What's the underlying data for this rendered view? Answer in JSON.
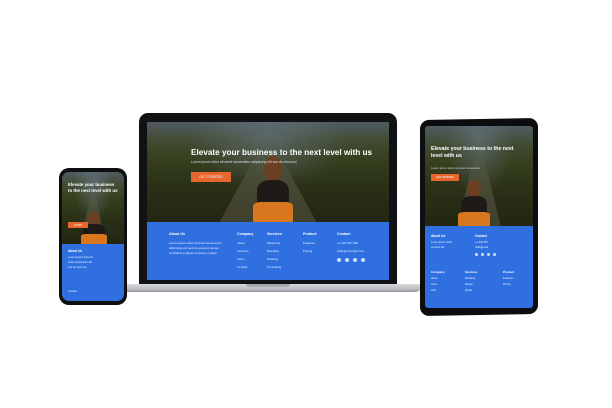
{
  "laptop": {
    "hero_title": "Elevate your business to the next level with us",
    "hero_subtitle": "Lorem ipsum dolor sit amet consectetur adipiscing elit sed do eiusmod",
    "cta_label": "GET STARTED",
    "footer": {
      "about_heading": "About Us",
      "about_lines": [
        "Lorem ipsum dolor sit amet consectetur",
        "adipiscing elit sed do eiusmod tempor",
        "incididunt ut labore et dolore magna"
      ],
      "col1_heading": "Company",
      "col1_items": [
        "About",
        "Services",
        "Team",
        "Contact"
      ],
      "col2_heading": "Services",
      "col2_items": [
        "Marketing",
        "Branding",
        "Strategy",
        "Consulting"
      ],
      "col3_heading": "Product",
      "col3_items": [
        "Features",
        "Pricing"
      ],
      "contact_heading": "Contact",
      "contact_lines": [
        "+1 234 567 890",
        "hello@example.com"
      ]
    }
  },
  "phone": {
    "hero_title": "Elevate your business to the next level with us",
    "cta_label": "START",
    "footer_heading": "About Us",
    "footer_lines": [
      "Lorem ipsum dolor sit",
      "amet consectetur elit",
      "sed do eiusmod"
    ],
    "footer_link": "Contact"
  },
  "tablet": {
    "hero_title": "Elevate your business to the next level with us",
    "hero_subtitle": "Lorem ipsum dolor sit amet consectetur",
    "cta_label": "GET STARTED",
    "footer": {
      "about_heading": "About Us",
      "about_lines": [
        "Lorem ipsum dolor",
        "sit amet elit"
      ],
      "contact_heading": "Contact",
      "contact_lines": [
        "+1 234 567",
        "hello@mail"
      ],
      "col1_heading": "Company",
      "col1_items": [
        "About",
        "Team",
        "Jobs"
      ],
      "col2_heading": "Services",
      "col2_items": [
        "Branding",
        "Design",
        "Social"
      ],
      "col3_heading": "Product",
      "col3_items": [
        "Features",
        "Pricing"
      ]
    }
  },
  "colors": {
    "footer_blue": "#2f6fe0",
    "cta_orange": "#e8652e",
    "device_black": "#111214"
  },
  "icons": [
    "facebook-icon",
    "twitter-icon",
    "instagram-icon",
    "linkedin-icon"
  ]
}
